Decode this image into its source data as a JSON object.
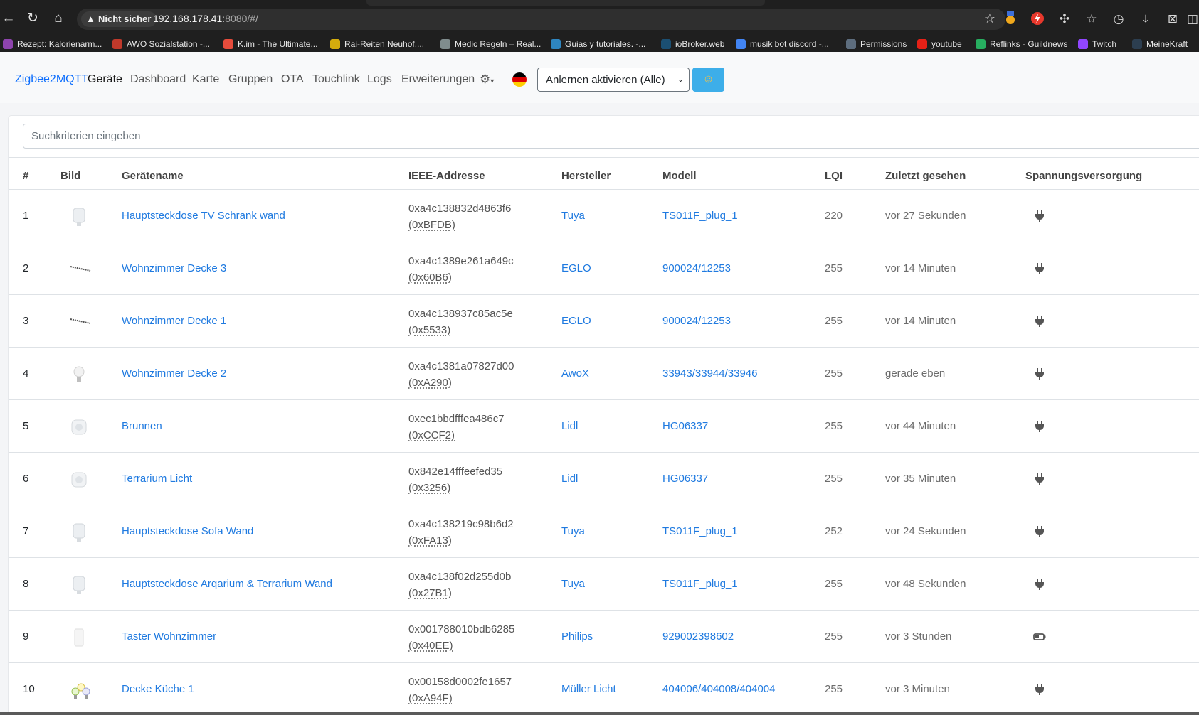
{
  "browser": {
    "security_label": "Nicht sicher",
    "url_main": "192.168.178.41",
    "url_rest": ":8080/#/",
    "bookmarks": [
      {
        "label": "Rezept: Kalorienarm...",
        "color": "#8e44ad"
      },
      {
        "label": "AWO Sozialstation -...",
        "color": "#c0392b"
      },
      {
        "label": "K.im - The Ultimate...",
        "color": "#e74c3c"
      },
      {
        "label": "Rai-Reiten Neuhof,...",
        "color": "#d4ac0d"
      },
      {
        "label": "Medic Regeln – Real...",
        "color": "#7f8c8d"
      },
      {
        "label": "Guias y tutoriales. -...",
        "color": "#2e86c1"
      },
      {
        "label": "ioBroker.web",
        "color": "#1b4f72"
      },
      {
        "label": "musik bot discord -...",
        "color": "#4285f4"
      },
      {
        "label": "Permissions",
        "color": "#5d6d7e"
      },
      {
        "label": "youtube",
        "color": "#e62117"
      },
      {
        "label": "Reflinks - Guildnews",
        "color": "#27ae60"
      },
      {
        "label": "Twitch",
        "color": "#9146ff"
      },
      {
        "label": "MeineKraft",
        "color": "#2c3e50"
      }
    ]
  },
  "nav": {
    "brand": "Zigbee2MQTT",
    "links": [
      "Geräte",
      "Dashboard",
      "Karte",
      "Gruppen",
      "OTA",
      "Touchlink",
      "Logs",
      "Erweiterungen"
    ],
    "active": "Geräte",
    "permit_join_label": "Anlernen aktivieren (Alle)",
    "theme_icon": "☺"
  },
  "search": {
    "placeholder": "Suchkriterien eingeben"
  },
  "table": {
    "headers": [
      "#",
      "Bild",
      "Gerätename",
      "IEEE-Addresse",
      "Hersteller",
      "Modell",
      "LQI",
      "Zuletzt gesehen",
      "Spannungsversorgung"
    ],
    "rows": [
      {
        "num": "1",
        "name": "Hauptsteckdose TV Schrank wand",
        "ieee": "0xa4c138832d4863f6",
        "nwk": "(0xBFDB)",
        "vendor": "Tuya",
        "model": "TS011F_plug_1",
        "lqi": "220",
        "seen": "vor 27 Sekunden",
        "power": "mains",
        "thumb": "plug"
      },
      {
        "num": "2",
        "name": "Wohnzimmer Decke 3",
        "ieee": "0xa4c1389e261a649c",
        "nwk": "(0x60B6)",
        "vendor": "EGLO",
        "model": "900024/12253",
        "lqi": "255",
        "seen": "vor 14 Minuten",
        "power": "mains",
        "thumb": "strip"
      },
      {
        "num": "3",
        "name": "Wohnzimmer Decke 1",
        "ieee": "0xa4c138937c85ac5e",
        "nwk": "(0x5533)",
        "vendor": "EGLO",
        "model": "900024/12253",
        "lqi": "255",
        "seen": "vor 14 Minuten",
        "power": "mains",
        "thumb": "strip"
      },
      {
        "num": "4",
        "name": "Wohnzimmer Decke 2",
        "ieee": "0xa4c1381a07827d00",
        "nwk": "(0xA290)",
        "vendor": "AwoX",
        "model": "33943/33944/33946",
        "lqi": "255",
        "seen": "gerade eben",
        "power": "mains",
        "thumb": "bulb"
      },
      {
        "num": "5",
        "name": "Brunnen",
        "ieee": "0xec1bbdfffea486c7",
        "nwk": "(0xCCF2)",
        "vendor": "Lidl",
        "model": "HG06337",
        "lqi": "255",
        "seen": "vor 44 Minuten",
        "power": "mains",
        "thumb": "socket"
      },
      {
        "num": "6",
        "name": "Terrarium Licht",
        "ieee": "0x842e14fffeefed35",
        "nwk": "(0x3256)",
        "vendor": "Lidl",
        "model": "HG06337",
        "lqi": "255",
        "seen": "vor 35 Minuten",
        "power": "mains",
        "thumb": "socket"
      },
      {
        "num": "7",
        "name": "Hauptsteckdose Sofa Wand",
        "ieee": "0xa4c138219c98b6d2",
        "nwk": "(0xFA13)",
        "vendor": "Tuya",
        "model": "TS011F_plug_1",
        "lqi": "252",
        "seen": "vor 24 Sekunden",
        "power": "mains",
        "thumb": "plug"
      },
      {
        "num": "8",
        "name": "Hauptsteckdose Arqarium & Terrarium Wand",
        "ieee": "0xa4c138f02d255d0b",
        "nwk": "(0x27B1)",
        "vendor": "Tuya",
        "model": "TS011F_plug_1",
        "lqi": "255",
        "seen": "vor 48 Sekunden",
        "power": "mains",
        "thumb": "plug"
      },
      {
        "num": "9",
        "name": "Taster Wohnzimmer",
        "ieee": "0x001788010bdb6285",
        "nwk": "(0x40EE)",
        "vendor": "Philips",
        "model": "929002398602",
        "lqi": "255",
        "seen": "vor 3 Stunden",
        "power": "battery",
        "thumb": "switch"
      },
      {
        "num": "10",
        "name": "Decke Küche 1",
        "ieee": "0x00158d0002fe1657",
        "nwk": "(0xA94F)",
        "vendor": "Müller Licht",
        "model": "404006/404008/404004",
        "lqi": "255",
        "seen": "vor 3 Minuten",
        "power": "mains",
        "thumb": "bulbs"
      }
    ]
  }
}
